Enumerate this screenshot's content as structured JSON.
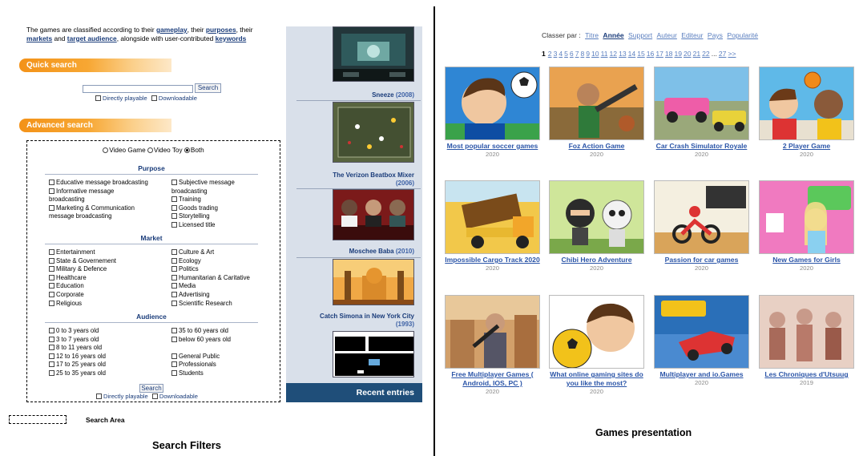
{
  "intro": {
    "t1": "The games are classified according to their ",
    "gameplay": "gameplay",
    "t2": ", their ",
    "purposes": "purposes",
    "t3": ", their ",
    "markets": "markets",
    "t4": " and ",
    "audience": "target audience",
    "t5": ", alongside with user-contributed ",
    "keywords": "keywords"
  },
  "quick_search": {
    "title": "Quick search",
    "button": "Search",
    "opt_playable": "Directly playable",
    "opt_downloadable": "Downloadable"
  },
  "advanced_search": {
    "title": "Advanced search",
    "types": [
      "Video Game",
      "Video Toy",
      "Both"
    ],
    "selected_type": "Both",
    "purpose_title": "Purpose",
    "purpose_left": [
      "Educative message broadcasting",
      "Informative message broadcasting",
      "Marketing & Communication message broadcasting"
    ],
    "purpose_right": [
      "Subjective message broadcasting",
      "Training",
      "Goods trading",
      "Storytelling",
      "Licensed title"
    ],
    "market_title": "Market",
    "market_left": [
      "Entertainment",
      "State & Governement",
      "Military & Defence",
      "Healthcare",
      "Education",
      "Corporate",
      "Religious"
    ],
    "market_right": [
      "Culture & Art",
      "Ecology",
      "Politics",
      "Humanitarian & Caritative",
      "Media",
      "Advertising",
      "Scientific Research"
    ],
    "audience_title": "Audience",
    "audience_left": [
      "0 to 3 years old",
      "3 to 7 years old",
      "8 to 11 years old",
      "12 to 16 years old",
      "17 to 25 years old",
      "25 to 35 years old"
    ],
    "audience_right": [
      "35 to 60 years old",
      "below 60 years old",
      "General Public",
      "Professionals",
      "Students"
    ],
    "button": "Search",
    "opt_playable": "Directly playable",
    "opt_downloadable": "Downloadable"
  },
  "legend_label": "Search Area",
  "left_caption": "Search Filters",
  "recent": {
    "entries": [
      {
        "title": "Sneeze",
        "year": "(2008)"
      },
      {
        "title": "The Verizon Beatbox Mixer",
        "year": "(2006)"
      },
      {
        "title": "Moschee Baba",
        "year": "(2010)"
      },
      {
        "title": "Catch Simona in New York City",
        "year": "(1993)"
      }
    ],
    "footer": "Recent entries"
  },
  "sort": {
    "label": "Classer par :",
    "options": [
      "Titre",
      "Année",
      "Support",
      "Auteur",
      "Editeur",
      "Pays",
      "Popularité"
    ],
    "active": "Année"
  },
  "pager": {
    "current": "1",
    "pages": [
      "2",
      "3",
      "4",
      "5",
      "6",
      "7",
      "8",
      "9",
      "10",
      "11",
      "12",
      "13",
      "14",
      "15",
      "16",
      "17",
      "18",
      "19",
      "20",
      "21",
      "22"
    ],
    "dots": "...",
    "last": "27",
    "next": ">>"
  },
  "games": [
    {
      "title": "Most popular soccer games",
      "year": "2020"
    },
    {
      "title": "Foz Action Game",
      "year": "2020"
    },
    {
      "title": "Car Crash Simulator Royale",
      "year": "2020"
    },
    {
      "title": "2 Player Game",
      "year": "2020"
    },
    {
      "title": "Impossible Cargo Track 2020",
      "year": "2020"
    },
    {
      "title": "Chibi Hero Adventure",
      "year": "2020"
    },
    {
      "title": "Passion for car games",
      "year": "2020"
    },
    {
      "title": "New Games for Girls",
      "year": "2020"
    },
    {
      "title": "Free Multiplayer Games ( Android, IOS, PC )",
      "year": "2020"
    },
    {
      "title": "What online gaming sites do you like the most?",
      "year": "2020"
    },
    {
      "title": "Multiplayer and io.Games",
      "year": "2020"
    },
    {
      "title": "Les Chroniques d'Utsuug",
      "year": "2019"
    }
  ],
  "right_caption": "Games presentation",
  "colors": {
    "link": "#1a3c7a",
    "banner_orange": "#f39218",
    "recent_footer": "#1f4e79",
    "game_title": "#2b55a8"
  }
}
